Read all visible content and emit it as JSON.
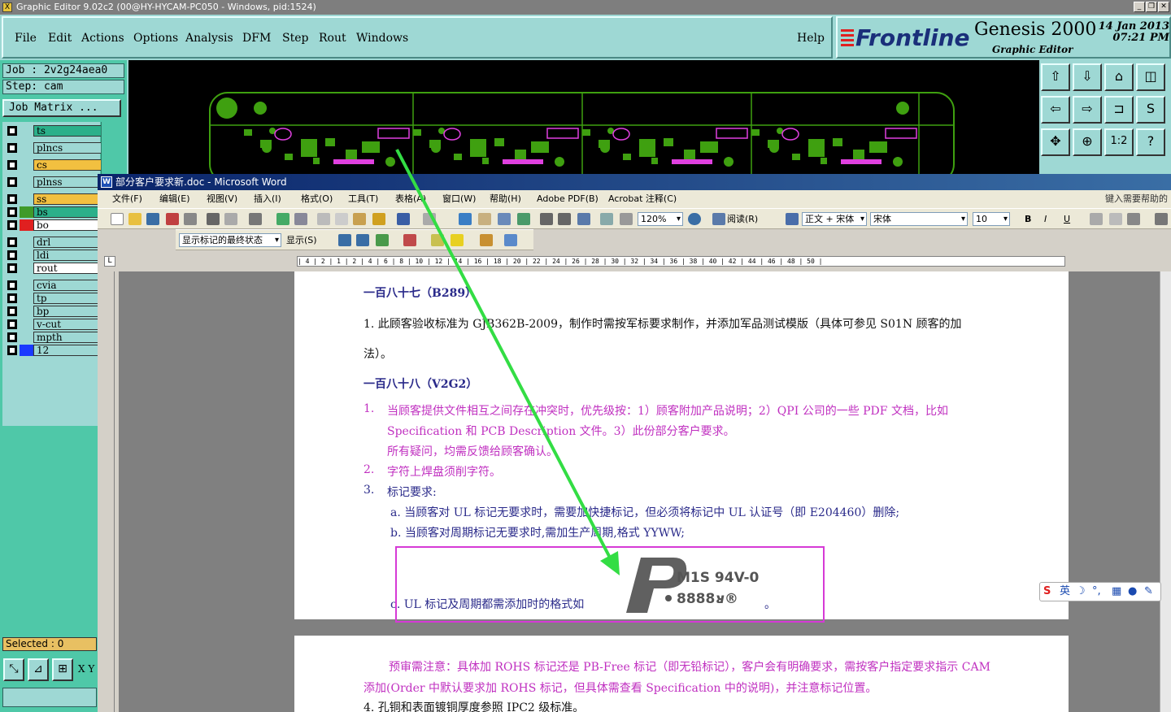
{
  "app": {
    "title": "Graphic Editor 9.02c2 (00@HY-HYCAM-PC050 - Windows, pid:1524)",
    "menu": [
      "File",
      "Edit",
      "Actions",
      "Options",
      "Analysis",
      "DFM",
      "Step",
      "Rout",
      "Windows"
    ],
    "help": "Help",
    "brand": "Frontline",
    "product": "Genesis 2000",
    "product_sub": "Graphic Editor",
    "date": "14 Jan 2013",
    "time": "07:21 PM"
  },
  "job": {
    "job_label": "Job : 2v2g24aea0",
    "step_label": "Step: cam",
    "matrix_button": "Job Matrix ..."
  },
  "layers": [
    {
      "name": "ts",
      "color": "#2bb08a"
    },
    {
      "name": "plncs",
      "color": "#9ed8d4"
    },
    {
      "name": "cs",
      "color": "#f2c040"
    },
    {
      "name": "plnss",
      "color": "#9ed8d4"
    },
    {
      "name": "ss",
      "color": "#f2c040"
    },
    {
      "name": "bs",
      "color": "#2bb08a",
      "swatch": "#3f9a2a"
    },
    {
      "name": "bo",
      "color": "#ffffff",
      "swatch": "#e02020"
    },
    {
      "name": "drl",
      "color": "#9ed8d4"
    },
    {
      "name": "ldi",
      "color": "#9ed8d4"
    },
    {
      "name": "rout",
      "color": "#ffffff"
    },
    {
      "name": "cvia",
      "color": "#9ed8d4"
    },
    {
      "name": "tp",
      "color": "#9ed8d4"
    },
    {
      "name": "bp",
      "color": "#9ed8d4"
    },
    {
      "name": "v-cut",
      "color": "#9ed8d4"
    },
    {
      "name": "mpth",
      "color": "#9ed8d4"
    },
    {
      "name": "12",
      "color": "#9ed8d4",
      "swatch": "#1a3aff"
    }
  ],
  "selected": "Selected : 0",
  "coord_label": "X Y",
  "word": {
    "title": "部分客户要求新.doc - Microsoft Word",
    "menu": [
      "文件(F)",
      "编辑(E)",
      "视图(V)",
      "插入(I)",
      "格式(O)",
      "工具(T)",
      "表格(A)",
      "窗口(W)",
      "帮助(H)",
      "Adobe PDF(B)",
      "Acrobat 注释(C)"
    ],
    "help_box": "键入需要帮助的",
    "zoom": "120%",
    "read_label": "阅读(R)",
    "style": "正文 + 宋体",
    "font": "宋体",
    "size": "10",
    "review_state": "显示标记的最终状态",
    "show_menu": "显示(S)",
    "ruler": "| 4 | 2 | 1 | 2 | 4 | 6 | 8 | 10 | 12 | 14 | 16 | 18 | 20 | 22 | 24 | 26 | 28 | 30 | 32 | 34 | 36 | 38 | 40 | 42 | 44 | 46 | 48 | 50 |",
    "doc": {
      "h1": "一百八十七（B289）",
      "p1a": "1. 此顾客验收标准为 GJB362B-2009，制作时需按军标要求制作，并添加军品测试模版（具体可参见 S01N 顾客的加",
      "p1b": "法）。",
      "h2": "一百八十八（V2G2）",
      "item1_num": "1.",
      "item1a": "当顾客提供文件相互之间存在冲突时，优先级按：1）顾客附加产品说明；2）QPI 公司的一些 PDF 文档，比如",
      "item1b": "Specification 和 PCB   Description 文件。3）此份部分客户要求。",
      "item1c": "所有疑问，均需反馈给顾客确认。",
      "item2_num": "2.",
      "item2": "字符上焊盘须削字符。",
      "item3_num": "3.",
      "item3": "标记要求:",
      "item3a": "a. 当顾客对 UL 标记无要求时，需要加快捷标记，但必须将标记中 UL 认证号（即 E204460）删除;",
      "item3b": "b. 当顾客对周期标记无要求时,需加生产周期,格式 YYWW;",
      "item3c": "c.  UL 标记及周期都需添加时的格式如",
      "item3c_end": "。",
      "ul_code": "M1S 94V-0",
      "ul_date": "8888",
      "note1": "预审需注意：具体加 ROHS 标记还是 PB-Free 标记（即无铅标记），客户会有明确要求，需按客户指定要求指示 CAM",
      "note2": "添加(Order 中默认要求加 ROHS 标记，但具体需查看 Specification 中的说明)，并注意标记位置。",
      "item4": "4. 孔铜和表面镀铜厚度参照 IPC2 级标准。"
    }
  },
  "ime": {
    "label": "英"
  },
  "colors": {
    "pcb_green": "#3fa010",
    "pcb_magenta": "#e040e0",
    "arrow": "#33dd44",
    "highlight": "#d63ad6"
  }
}
